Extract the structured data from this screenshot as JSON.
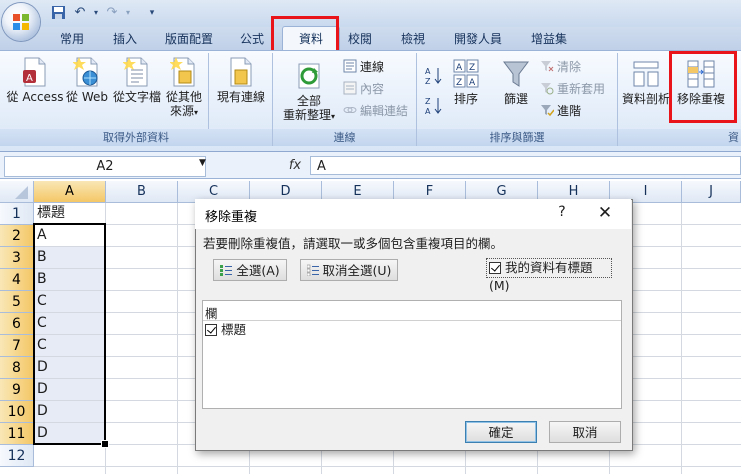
{
  "tabs": [
    "常用",
    "插入",
    "版面配置",
    "公式",
    "資料",
    "校閱",
    "檢視",
    "開發人員",
    "增益集"
  ],
  "ribbon": {
    "get_external": {
      "buttons": [
        "從 Access",
        "從 Web",
        "從文字檔",
        "從其他",
        "來源"
      ],
      "existing": "現有連線",
      "label": "取得外部資料"
    },
    "connections": {
      "refresh_line1": "全部",
      "refresh_line2": "重新整理",
      "links": [
        "連線",
        "內容",
        "編輯連結"
      ],
      "label": "連線"
    },
    "sort_filter": {
      "sort": "排序",
      "filter": "篩選",
      "clear": "清除",
      "reapply": "重新套用",
      "advanced": "進階",
      "label": "排序與篩選"
    },
    "data_tools": {
      "text_to_cols": "資料剖析",
      "remove_dup": "移除重複",
      "label": "資"
    }
  },
  "formula_bar": {
    "name_box": "A2",
    "fx": "fx",
    "value": "A"
  },
  "columns": [
    "A",
    "B",
    "C",
    "D",
    "E",
    "F",
    "G",
    "H",
    "I",
    "J"
  ],
  "rows": [
    "1",
    "2",
    "3",
    "4",
    "5",
    "6",
    "7",
    "8",
    "9",
    "10",
    "11",
    "12"
  ],
  "cells_a": [
    "標題",
    "A",
    "B",
    "B",
    "C",
    "C",
    "C",
    "D",
    "D",
    "D",
    "D",
    ""
  ],
  "dialog": {
    "title": "移除重複",
    "help": "?",
    "close": "✕",
    "instruction": "若要刪除重複值，請選取一或多個包含重複項目的欄。",
    "select_all": "全選(A)",
    "unselect_all": "取消全選(U)",
    "has_headers": "我的資料有標題(M)",
    "list_header": "欄",
    "list_items": [
      "標題"
    ],
    "ok": "確定",
    "cancel": "取消"
  },
  "colors": {
    "highlight_red": "#e8141a",
    "ribbon_blue": "#dbe6f6",
    "selection_orange": "#f4c766"
  }
}
